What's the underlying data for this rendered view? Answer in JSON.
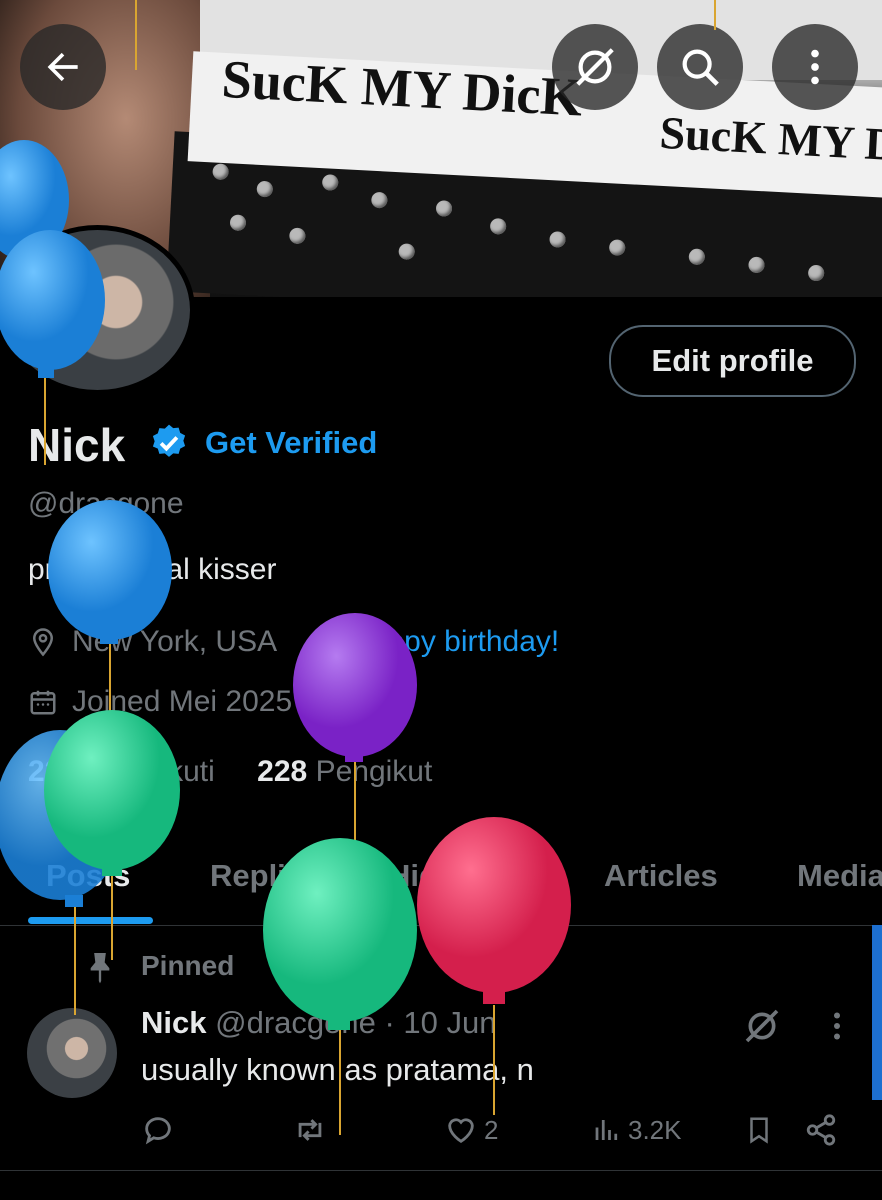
{
  "banner": {
    "band_text_1": "SucK MY DicK",
    "band_text_2": "SucK MY DicK"
  },
  "topbar": {
    "back_icon": "arrow-left-icon",
    "grok_icon": "grok-icon",
    "search_icon": "search-icon",
    "more_icon": "more-vertical-icon"
  },
  "profile": {
    "edit_label": "Edit profile",
    "name": "Nick",
    "get_verified": "Get Verified",
    "handle": "@dracgone",
    "bio": "professional kisser",
    "location": "New York, USA",
    "birthday_link": "Happy birthday!",
    "joined": "Joined Mei 2025",
    "following_count": "226",
    "following_label": "Mengikuti",
    "followers_count": "228",
    "followers_label": "Pengikut"
  },
  "tabs": [
    "Posts",
    "Replies",
    "Highlights",
    "Articles",
    "Media"
  ],
  "post": {
    "pinned_label": "Pinned",
    "author": "Nick",
    "handle_time": "@dracgone · 10 Jun",
    "text": "usually known as pratama, n",
    "likes": "2",
    "views": "3.2K"
  },
  "colors": {
    "accent": "#1d9bf0",
    "muted": "#71767b",
    "background": "#000000"
  }
}
